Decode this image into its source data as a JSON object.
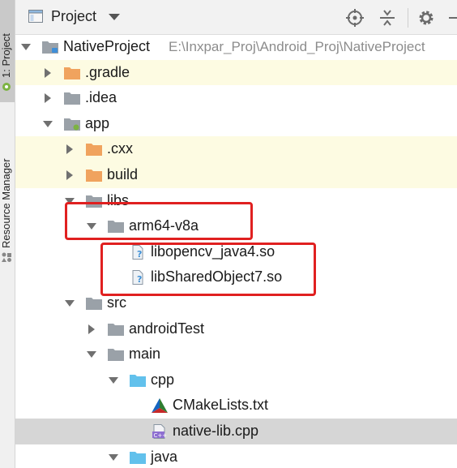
{
  "side_tabs": {
    "project_label": "1: Project",
    "resource_manager_label": "Resource Manager"
  },
  "header": {
    "title": "Project"
  },
  "tree": [
    {
      "id": "native-project",
      "label": "NativeProject",
      "path": "E:\\Inxpar_Proj\\Android_Proj\\NativeProject",
      "icon": "module-folder-icon",
      "expanded": true
    },
    {
      "id": "gradle",
      "label": ".gradle",
      "icon": "orange-folder-icon",
      "expanded": false
    },
    {
      "id": "idea",
      "label": ".idea",
      "icon": "grey-folder-icon",
      "expanded": false
    },
    {
      "id": "app",
      "label": "app",
      "icon": "module-folder-icon",
      "expanded": true
    },
    {
      "id": "cxx",
      "label": ".cxx",
      "icon": "orange-folder-icon",
      "expanded": false
    },
    {
      "id": "build",
      "label": "build",
      "icon": "orange-folder-icon",
      "expanded": false
    },
    {
      "id": "libs",
      "label": "libs",
      "icon": "grey-folder-icon",
      "expanded": true
    },
    {
      "id": "arm64",
      "label": "arm64-v8a",
      "icon": "grey-folder-icon",
      "expanded": true
    },
    {
      "id": "libopencv",
      "label": "libopencv_java4.so",
      "icon": "unknown-file-icon"
    },
    {
      "id": "libshared",
      "label": "libSharedObject7.so",
      "icon": "unknown-file-icon"
    },
    {
      "id": "src",
      "label": "src",
      "icon": "grey-folder-icon",
      "expanded": true
    },
    {
      "id": "androidtest",
      "label": "androidTest",
      "icon": "grey-folder-icon",
      "expanded": false
    },
    {
      "id": "main",
      "label": "main",
      "icon": "grey-folder-icon",
      "expanded": true
    },
    {
      "id": "cpp",
      "label": "cpp",
      "icon": "blue-folder-icon",
      "expanded": true
    },
    {
      "id": "cmakelists",
      "label": "CMakeLists.txt",
      "icon": "cmake-icon"
    },
    {
      "id": "nativelib",
      "label": "native-lib.cpp",
      "icon": "cpp-file-icon",
      "selected": true
    },
    {
      "id": "java",
      "label": "java",
      "icon": "blue-folder-icon",
      "expanded": true
    }
  ],
  "colors": {
    "highlight_box": "#e02020",
    "excluded_row_bg": "#fdfbe2",
    "selected_row_bg": "#d6d6d6",
    "orange_folder": "#f0a35e",
    "grey_folder": "#9aa1a8",
    "blue_folder": "#62c1ec"
  }
}
